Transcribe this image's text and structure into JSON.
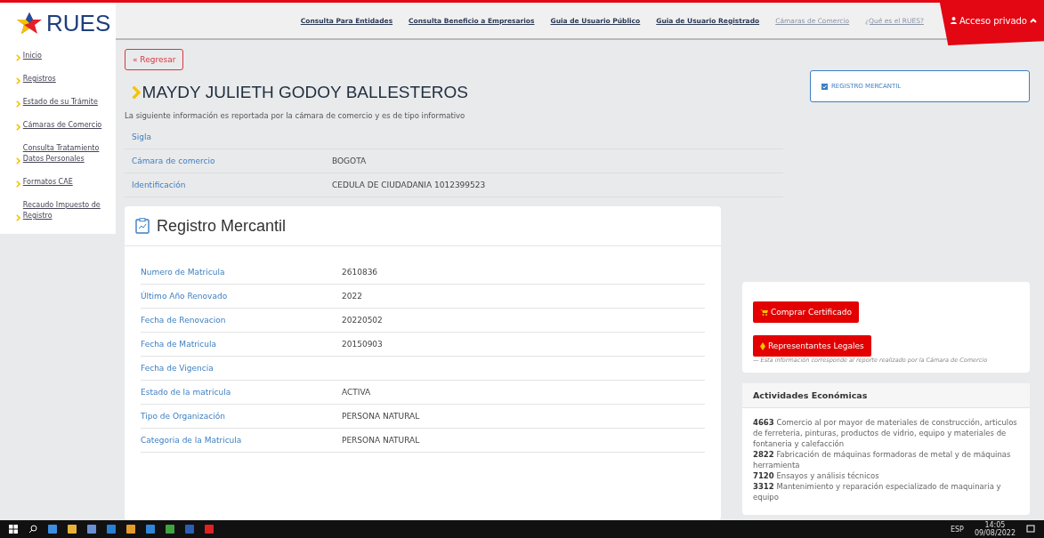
{
  "logo": {
    "text": "RUES"
  },
  "nav": [
    {
      "label": "Consulta Para Entidades",
      "kind": "primary"
    },
    {
      "label": "Consulta Beneficio a Empresarios",
      "kind": "primary"
    },
    {
      "label": "Guia de Usuario Público",
      "kind": "primary"
    },
    {
      "label": "Guia de Usuario Registrado",
      "kind": "primary"
    },
    {
      "label": "Cámaras de Comercio",
      "kind": "secondary"
    },
    {
      "label": "¿Qué es el RUES?",
      "kind": "secondary"
    }
  ],
  "access": {
    "label": "Acceso privado"
  },
  "sidebar": {
    "items": [
      {
        "label": "Inicio"
      },
      {
        "label": "Registros"
      },
      {
        "label": "Estado de su Trámite"
      },
      {
        "label": "Cámaras de Comercio"
      },
      {
        "label": "Consulta Tratamiento Datos Personales"
      },
      {
        "label": "Formatos CAE"
      },
      {
        "label": "Recaudo Impuesto de Registro"
      }
    ]
  },
  "back_button": "« Regresar",
  "title": "MAYDY JULIETH GODOY BALLESTEROS",
  "subtitle": "La siguiente información es reportada por la cámara de comercio y es de tipo informativo",
  "registry_filter": {
    "label": "REGISTRO MERCANTIL",
    "checked": true
  },
  "summary": [
    {
      "label": "Sigla"
    },
    {
      "label": "Cámara de comercio",
      "value": "BOGOTA"
    },
    {
      "label": "Identificación",
      "value": "CEDULA DE CIUDADANIA 1012399523"
    }
  ],
  "registro": {
    "title": "Registro Mercantil",
    "rows": [
      {
        "label": "Numero de Matricula",
        "value": "2610836"
      },
      {
        "label": "Último Año Renovado",
        "value": "2022"
      },
      {
        "label": "Fecha de Renovacion",
        "value": "20220502"
      },
      {
        "label": "Fecha de Matricula",
        "value": "20150903"
      },
      {
        "label": "Fecha de Vigencia"
      },
      {
        "label": "Estado de la matricula",
        "value": "ACTIVA"
      },
      {
        "label": "Tipo de Organización",
        "value": "PERSONA NATURAL"
      },
      {
        "label": "Categoria de la Matricula",
        "value": "PERSONA NATURAL"
      }
    ]
  },
  "actions": [
    {
      "label": "Comprar Certificado",
      "kind": "cart"
    },
    {
      "label": "Representantes Legales",
      "kind": "person"
    }
  ],
  "actions_note": "— Esta información corresponde al reporte realizado por la Cámara de Comercio",
  "activities": {
    "title": "Actividades Económicas",
    "items": [
      {
        "code": "4663",
        "text": "Comercio al por mayor de materiales de construcción, articulos de ferreteria, pinturas, productos de vidrio, equipo y materiales de fontaneria y calefacción"
      },
      {
        "code": "2822",
        "text": "Fabricación de máquinas formadoras de metal y de máquinas herramienta"
      },
      {
        "code": "7120",
        "text": "Ensayos y análisis técnicos"
      },
      {
        "code": "3312",
        "text": "Mantenimiento y reparación especializado de maquinaria y equipo"
      }
    ]
  },
  "taskbar": {
    "language": "ESP",
    "time": "14:05",
    "date": "09/08/2022"
  }
}
